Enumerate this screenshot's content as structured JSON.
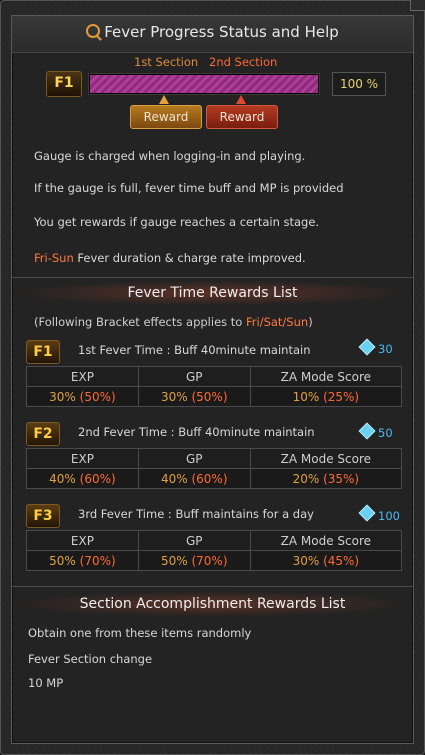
{
  "window": {
    "title": "Fever Progress Status and Help"
  },
  "progress": {
    "tier_badge": "F1",
    "section1_label": "1st Section",
    "section2_label": "2nd Section",
    "percent_text": "100 %",
    "fill": 1.0,
    "reward1_label": "Reward",
    "reward2_label": "Reward"
  },
  "help": {
    "line1": "Gauge is charged when logging-in and playing.",
    "line2": "If the gauge is full, fever time buff and MP is provided",
    "line3": "You get rewards if gauge reaches a certain stage.",
    "line4_highlight": "Fri-Sun",
    "line4_rest": " Fever duration & charge rate improved."
  },
  "rewards_list": {
    "heading": "Fever Time Rewards List",
    "note_prefix": "(Following Bracket effects applies to ",
    "note_days": "Fri/Sat/Sun",
    "note_suffix": ")",
    "columns": [
      "EXP",
      "GP",
      "ZA Mode Score"
    ],
    "tiers": [
      {
        "badge": "F1",
        "text": "1st Fever Time : Buff 40minute maintain",
        "gems": "30",
        "values": [
          {
            "base": "30% ",
            "bonus": "(50%)"
          },
          {
            "base": "30% ",
            "bonus": "(50%)"
          },
          {
            "base": "10% ",
            "bonus": "(25%)"
          }
        ]
      },
      {
        "badge": "F2",
        "text": "2nd Fever Time : Buff 40minute maintain",
        "gems": "50",
        "values": [
          {
            "base": "40% ",
            "bonus": "(60%)"
          },
          {
            "base": "40% ",
            "bonus": "(60%)"
          },
          {
            "base": "20% ",
            "bonus": "(35%)"
          }
        ]
      },
      {
        "badge": "F3",
        "text": "3rd Fever Time : Buff maintains for a day",
        "gems": "100",
        "values": [
          {
            "base": "50% ",
            "bonus": "(70%)"
          },
          {
            "base": "50% ",
            "bonus": "(70%)"
          },
          {
            "base": "30% ",
            "bonus": "(45%)"
          }
        ]
      }
    ]
  },
  "accomplishment": {
    "heading": "Section Accomplishment Rewards List",
    "line1": "Obtain one from these items randomly",
    "line2": "Fever Section change",
    "line3": "10 MP"
  },
  "colors": {
    "accent_orange": "#ff7a3c",
    "gem_blue": "#4fb8f0",
    "value_gold": "#e0a040"
  }
}
